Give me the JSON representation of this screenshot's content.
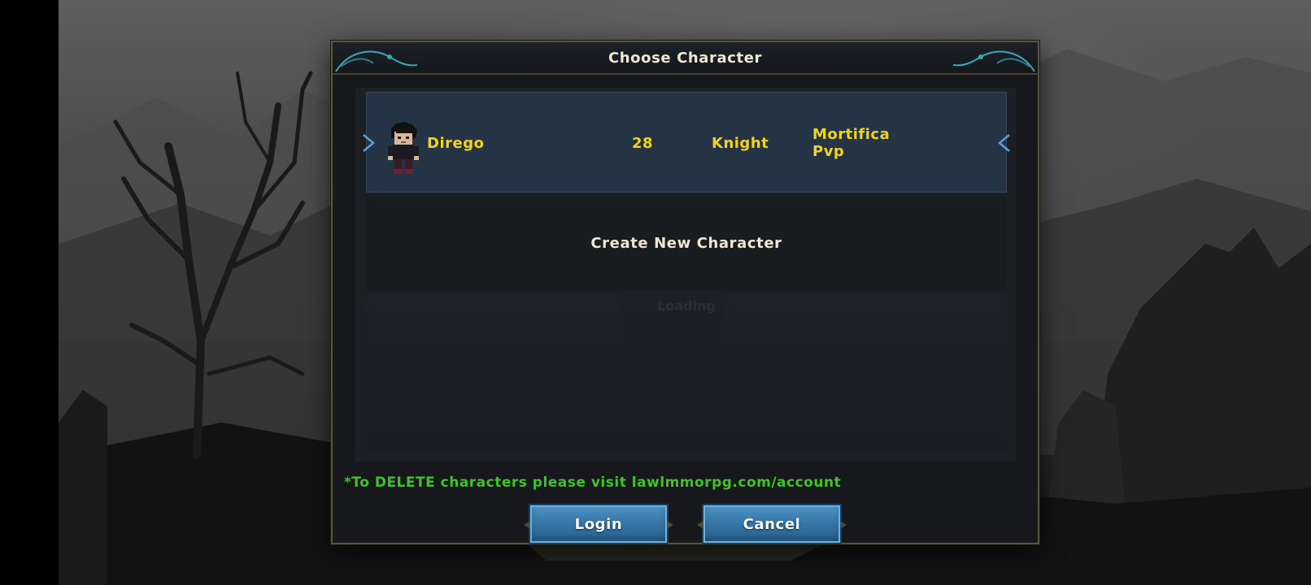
{
  "dialog": {
    "title": "Choose Character"
  },
  "character": {
    "name": "Dirego",
    "level": "28",
    "class": "Knight",
    "world_line1": "Mortifica",
    "world_line2": "Pvp"
  },
  "create_label": "Create New Character",
  "faded_text": "Loading",
  "delete_notice": "*To DELETE characters please visit lawlmmorpg.com/account",
  "buttons": {
    "login": "Login",
    "cancel": "Cancel"
  },
  "colors": {
    "name_text": "#f2d41c",
    "notice_text": "#3fc22a",
    "button": "#3575a6",
    "selected_row": "#253445"
  }
}
